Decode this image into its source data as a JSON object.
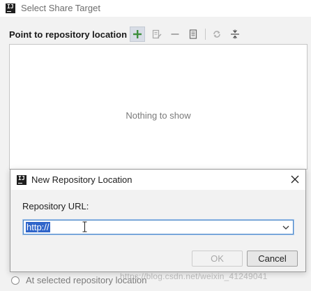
{
  "window": {
    "title": "Select Share Target",
    "app_icon_letters": "IJ"
  },
  "toolbar": {
    "section_label": "Point to repository location",
    "icons": [
      "add-icon",
      "edit-icon",
      "remove-icon",
      "properties-icon",
      "refresh-icon",
      "collapse-icon"
    ]
  },
  "list": {
    "empty_text": "Nothing to show"
  },
  "options": {
    "at_selected_label": "At selected repository location"
  },
  "watermark": {
    "text": "https://blog.csdn.net/weixin_41249041"
  },
  "dialog": {
    "title": "New Repository Location",
    "app_icon_letters": "IJ",
    "url_label": "Repository URL:",
    "url_value": "http://",
    "ok_label": "OK",
    "cancel_label": "Cancel"
  },
  "colors": {
    "add_green": "#3d8f3d",
    "selection_blue": "#2f65ca",
    "focus_border": "#4a86c8"
  }
}
